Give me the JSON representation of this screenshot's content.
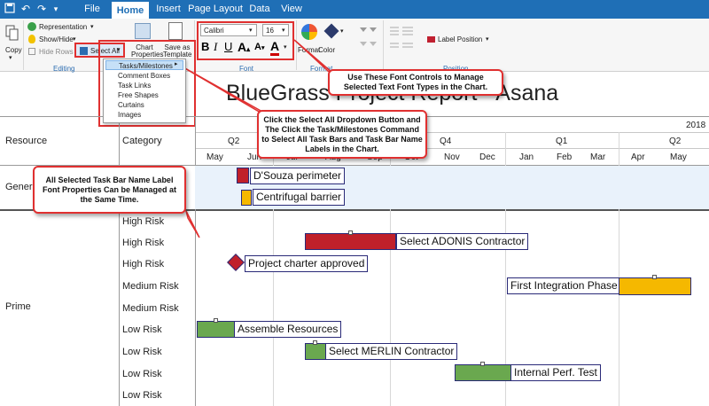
{
  "app": {
    "tabs": [
      "File",
      "Home",
      "Insert",
      "Page Layout",
      "Data",
      "View"
    ],
    "active_tab": "Home"
  },
  "ribbon": {
    "copy_label": "Copy",
    "representation_label": "Representation",
    "showhide_label": "Show/Hide",
    "hide_rows_label": "Hide Rows",
    "editing_label": "Editing",
    "select_all_label": "Select All",
    "chart_properties_label": "Chart Properties",
    "save_template_label": "Save as Template",
    "font_name": "Calibri",
    "font_size": "16",
    "bold_label": "B",
    "italic_label": "I",
    "underline_label": "U",
    "font_group_label": "Font",
    "format_label": "Format",
    "color_label": "Color",
    "label_position_label": "Label Position",
    "format_group_label": "Format",
    "position_group_label": "Position"
  },
  "dropdown": {
    "items": [
      "Tasks/Milestones",
      "Comment Boxes",
      "Task Links",
      "Free Shapes",
      "Curtains",
      "Images"
    ]
  },
  "chart": {
    "title": "BlueGrass Project Report - Asana",
    "col_resource": "Resource",
    "col_category": "Category",
    "year": "2018",
    "quarters": [
      "Q2",
      "Q3",
      "Q4",
      "Q1",
      "Q2"
    ],
    "months": [
      "May",
      "Jun",
      "Jul",
      "Aug",
      "Sep",
      "Oct",
      "Nov",
      "Dec",
      "Jan",
      "Feb",
      "Mar",
      "Apr",
      "May"
    ],
    "resources": [
      "General",
      "Prime"
    ],
    "categories": [
      "High Risk",
      "Medium Risk",
      "High Risk",
      "High Risk",
      "High Risk",
      "Medium Risk",
      "Medium Risk",
      "Low Risk",
      "Low Risk",
      "Low Risk",
      "Low Risk"
    ],
    "tasks": [
      {
        "name": "D'Souza perimeter",
        "color": "#c0202a"
      },
      {
        "name": "Centrifugal barrier",
        "color": "#f5b800"
      },
      {
        "name": "Select ADONIS Contractor",
        "color": "#c0202a"
      },
      {
        "name": "Project charter approved",
        "color": "#c0202a"
      },
      {
        "name": "First Integration Phase",
        "color": "#f5b800"
      },
      {
        "name": "Assemble Resources",
        "color": "#6aa84f"
      },
      {
        "name": "Select MERLIN Contractor",
        "color": "#6aa84f"
      },
      {
        "name": "Internal Perf. Test",
        "color": "#6aa84f"
      }
    ]
  },
  "callouts": {
    "font_controls": "Use These Font Controls to Manage Selected Text Font Types in the Chart.",
    "select_all": "Click the Select All Dropdown Button and The Click the Task/Milestones Command to Select All Task Bars and Task Bar Name Labels in the Chart.",
    "task_labels": "All Selected Task Bar Name Label Font Properties Can be Managed at the Same Time."
  }
}
